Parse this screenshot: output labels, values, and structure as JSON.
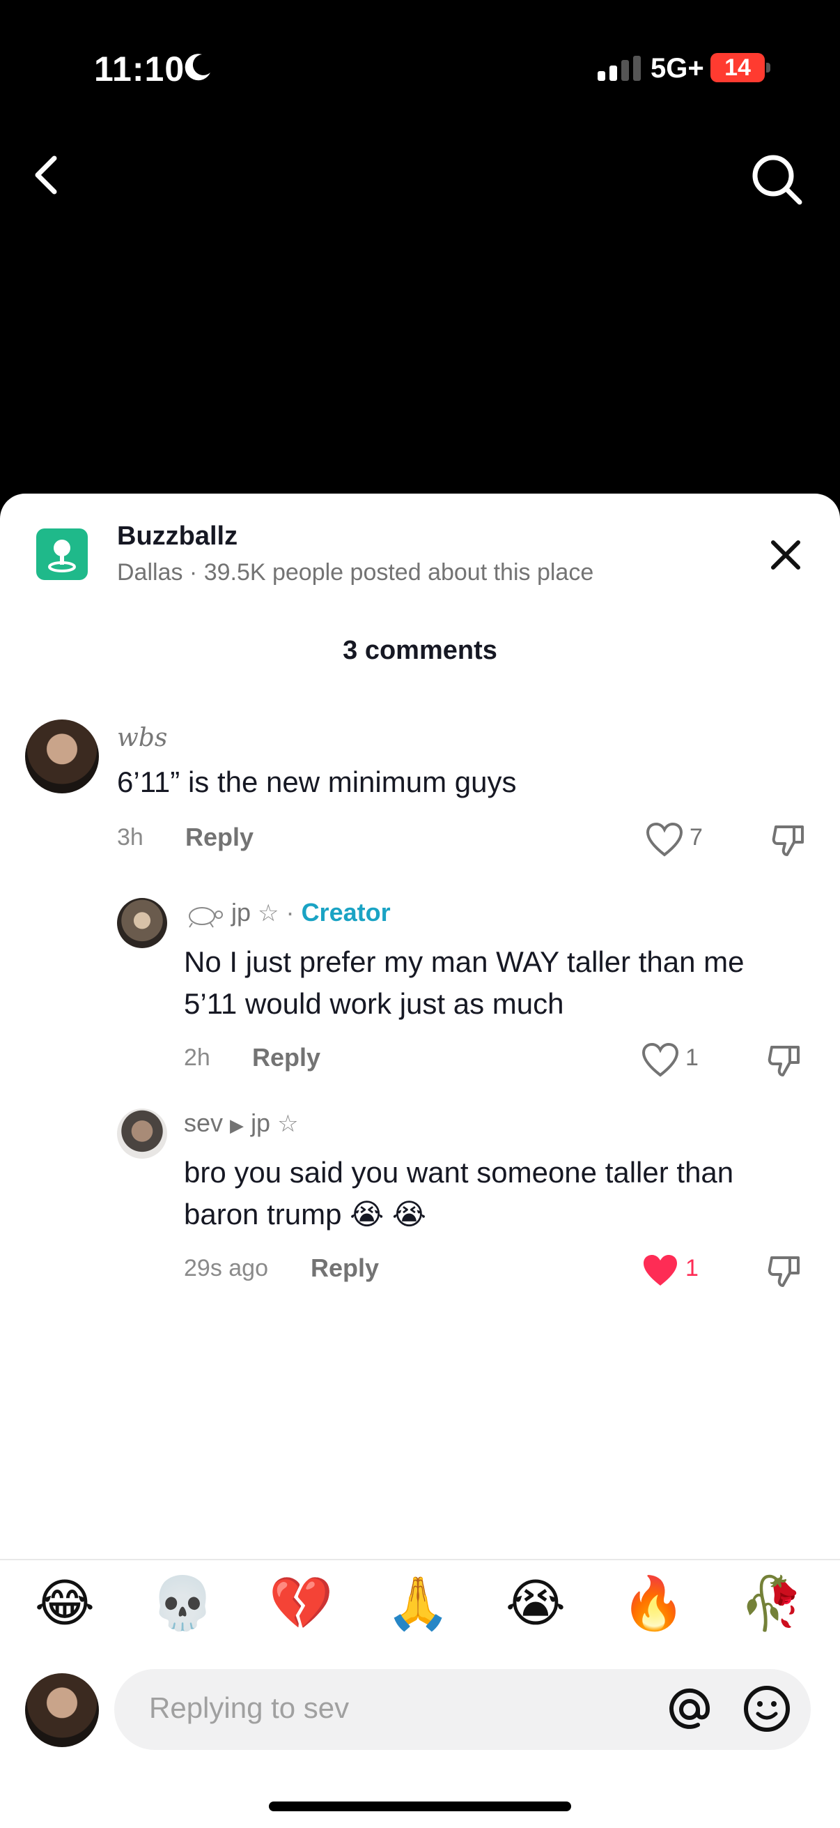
{
  "status": {
    "time": "11:10",
    "network": "5G+",
    "battery": "14"
  },
  "place": {
    "title": "Buzzballz",
    "subtitle": "Dallas · 39.5K people posted about this place"
  },
  "comments_header": "3 comments",
  "comments": [
    {
      "author": "wbs",
      "text": "6’11” is the new minimum guys",
      "time": "3h",
      "reply": "Reply",
      "likes": "7"
    },
    {
      "author": "jp",
      "badge": "Creator",
      "text_line1": "No I just prefer my man WAY taller than me",
      "text_line2": "5’11 would work just as much",
      "time": "2h",
      "reply": "Reply",
      "likes": "1"
    },
    {
      "author": "sev",
      "reply_to": "jp",
      "text_line1": "bro you said you want someone taller than",
      "text_line2": "baron trump 😭 😭",
      "time": "29s ago",
      "reply": "Reply",
      "likes": "1",
      "liked": true
    }
  ],
  "quick_emojis": [
    "😂",
    "💀",
    "💔",
    "🙏",
    "😭",
    "🔥",
    "🥀"
  ],
  "input": {
    "placeholder": "Replying to sev"
  },
  "colors": {
    "accent": "#1aa3c4",
    "like_active": "#fe2c55",
    "place_icon": "#1fb98a"
  },
  "icons": [
    "back-chevron-icon",
    "search-icon",
    "close-icon",
    "heart-icon",
    "dislike-icon",
    "at-icon",
    "smiley-icon"
  ]
}
